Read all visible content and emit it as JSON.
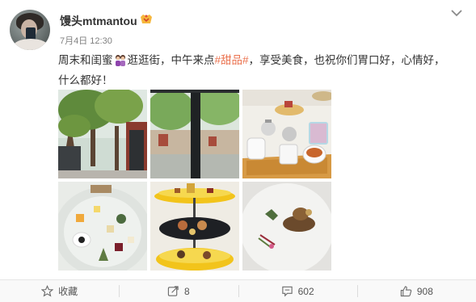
{
  "post": {
    "username": "馒头mtmantou",
    "timestamp": "7月4日 12:30",
    "text_line1_before": "周末和闺蜜",
    "text_line1_middle": "逛逛街，中午来点",
    "hashtag": "#甜品#",
    "text_line1_after": "，享受美食，也祝你们胃口好，心情好，",
    "text_line2": "什么都好！",
    "emoji": "two-women-emoji",
    "badge_icon": "vip-badge-icon",
    "photos": [
      {
        "name": "photo-trees-courtyard"
      },
      {
        "name": "photo-window-trees"
      },
      {
        "name": "photo-tea-set"
      },
      {
        "name": "photo-plated-dessert"
      },
      {
        "name": "photo-dessert-tower"
      },
      {
        "name": "photo-plated-dish"
      }
    ]
  },
  "actions": {
    "favorite_label": "收藏",
    "repost_count": "8",
    "comment_count": "602",
    "like_count": "908"
  },
  "colors": {
    "hashtag": "#eb7350",
    "action_bar": "#f9f9f9",
    "text": "#333333",
    "meta": "#808080"
  }
}
